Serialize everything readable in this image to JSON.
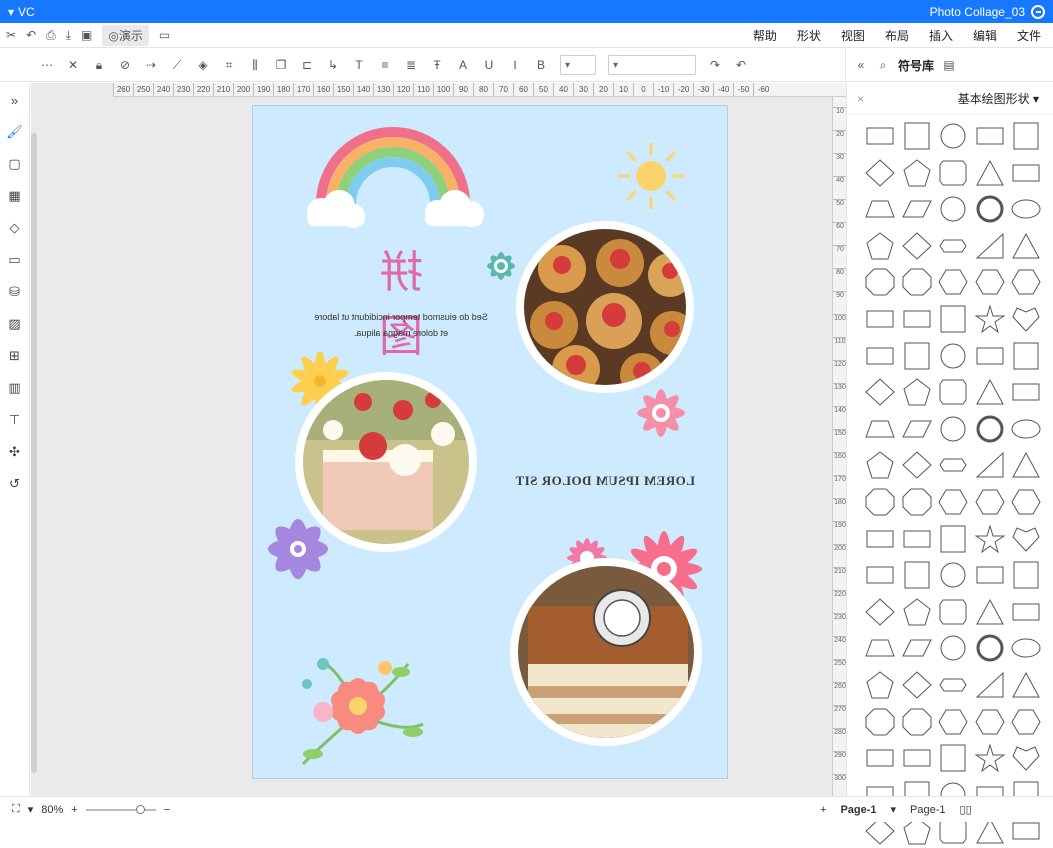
{
  "titlebar": {
    "app_menu": "VC",
    "doc_title": "Photo Collage_03"
  },
  "menubar": {
    "demo_label": "演示",
    "items": [
      "文件",
      "编辑",
      "插入",
      "布局",
      "视图",
      "形状",
      "帮助"
    ]
  },
  "toolbar": {
    "symbol_lib_title": "符号库"
  },
  "ruler": {
    "h_labels": [
      "-60",
      "-50",
      "-40",
      "-30",
      "-20",
      "-10",
      "0",
      "10",
      "20",
      "30",
      "40",
      "50",
      "60",
      "70",
      "80",
      "90",
      "100",
      "110",
      "120",
      "130",
      "140",
      "150",
      "160",
      "170",
      "180",
      "190",
      "200",
      "210",
      "220",
      "230",
      "240",
      "250",
      "260"
    ],
    "v_labels": [
      "10",
      "20",
      "30",
      "40",
      "50",
      "60",
      "70",
      "80",
      "90",
      "100",
      "110",
      "120",
      "130",
      "140",
      "150",
      "160",
      "170",
      "180",
      "190",
      "200",
      "210",
      "220",
      "230",
      "240",
      "250",
      "260",
      "270",
      "280",
      "290",
      "300"
    ]
  },
  "panel": {
    "category_title": "基本绘图形状"
  },
  "page": {
    "title": "拼 图",
    "body": "Sed do eiusmod tempor incididunt ut labore et dolore magna aliqua.",
    "heading": "LOREM IPSUM DOLOR SIT"
  },
  "statusbar": {
    "zoom": "80%",
    "page_selector": "Page-1",
    "page_tab": "Page-1"
  },
  "colors": {
    "accent": "#1677ff",
    "page_bg": "#cdeaff",
    "title_pink": "#e06aa7"
  }
}
